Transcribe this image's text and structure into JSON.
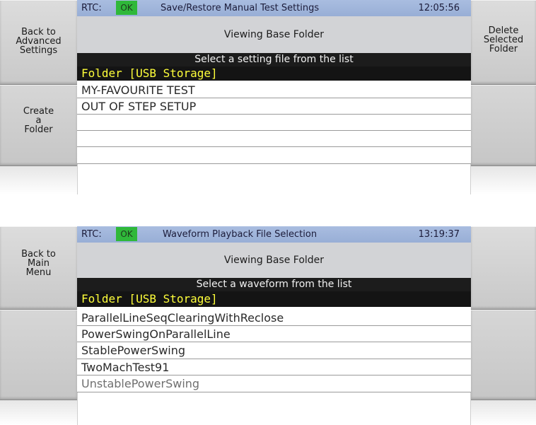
{
  "screen1": {
    "header": {
      "rtc_label": "RTC:",
      "rtc_status": "OK",
      "title": "Save/Restore Manual Test Settings",
      "time": "12:05:56"
    },
    "subtitle": "Viewing Base Folder",
    "prompt": "Select a setting file from the list",
    "folder": "Folder [USB Storage]",
    "files": [
      "MY-FAVOURITE TEST",
      "OUT OF STEP SETUP",
      "",
      "",
      ""
    ],
    "left_buttons": {
      "back": "Back to\nAdvanced\nSettings",
      "create": "Create\na\nFolder"
    },
    "right_buttons": {
      "delete": "Delete\nSelected\nFolder"
    }
  },
  "screen2": {
    "header": {
      "rtc_label": "RTC:",
      "rtc_status": "OK",
      "title": "Waveform Playback File Selection",
      "time": "13:19:37"
    },
    "subtitle": "Viewing Base Folder",
    "prompt": "Select a waveform from the list",
    "folder": "Folder [USB Storage]",
    "files": [
      "ParallelLineSeqClearingWithReclose",
      "PowerSwingOnParallelLine",
      "StablePowerSwing",
      "TwoMachTest91",
      "UnstablePowerSwing"
    ],
    "left_buttons": {
      "back": "Back to\nMain\nMenu"
    }
  },
  "colors": {
    "header_bg": "#a9bde0",
    "ok_green": "#2fb83a",
    "folder_text": "#ffff3a",
    "prompt_bg": "#1c1c1c"
  }
}
